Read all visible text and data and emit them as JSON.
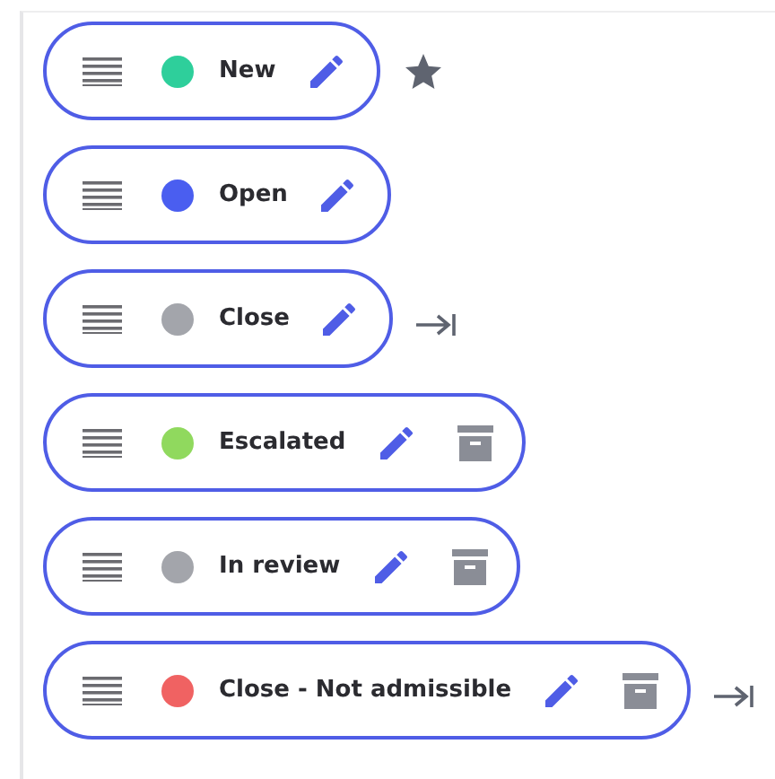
{
  "statuses": [
    {
      "label": "New",
      "color": "#2ecf9b",
      "archivable": false,
      "starred": true,
      "end_marker": false
    },
    {
      "label": "Open",
      "color": "#4a5ef0",
      "archivable": false,
      "starred": false,
      "end_marker": false
    },
    {
      "label": "Close",
      "color": "#a3a5ab",
      "archivable": false,
      "starred": false,
      "end_marker": true
    },
    {
      "label": "Escalated",
      "color": "#90d95e",
      "archivable": true,
      "starred": false,
      "end_marker": false
    },
    {
      "label": "In review",
      "color": "#a3a5ab",
      "archivable": true,
      "starred": false,
      "end_marker": false
    },
    {
      "label": "Close - Not admissible",
      "color": "#f06262",
      "archivable": true,
      "starred": false,
      "end_marker": true
    }
  ]
}
